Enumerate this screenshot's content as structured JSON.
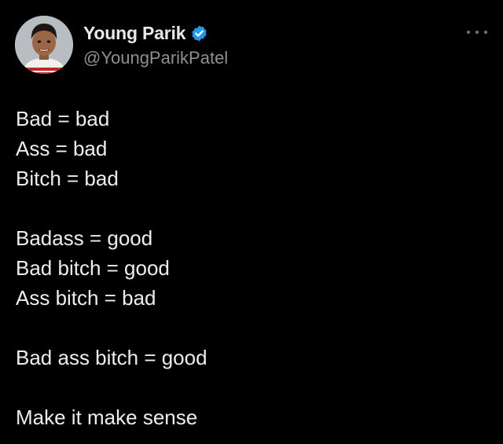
{
  "author": {
    "display_name": "Young Parik",
    "handle": "@YoungParikPatel",
    "verified": true,
    "verified_icon": "verified-badge-icon",
    "verified_color": "#1d9bf0"
  },
  "more_icon": "more-options-icon",
  "tweet": {
    "lines": [
      "Bad = bad",
      "Ass = bad",
      "Bitch = bad",
      "",
      "Badass = good",
      "Bad bitch = good",
      "Ass bitch = bad",
      "",
      "Bad ass bitch = good",
      "",
      "Make it make sense"
    ]
  },
  "colors": {
    "background": "#000000",
    "text": "#e7e9ea",
    "secondary_text": "#8b9096"
  }
}
